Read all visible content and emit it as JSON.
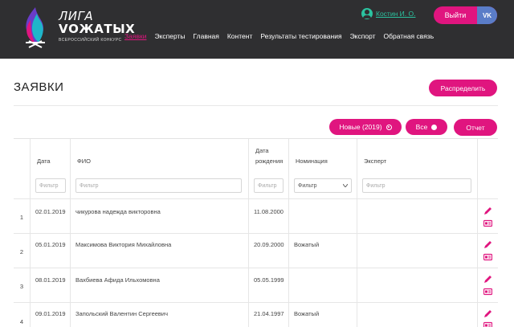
{
  "header": {
    "logo_line1": "ЛИГА",
    "logo_line2": "VОЖАТЫХ",
    "logo_sub": "всероссийский конкурс",
    "nav": [
      "Заявки",
      "Эксперты",
      "Главная",
      "Контент",
      "Результаты тестирования",
      "Экспорт",
      "Обратная связь"
    ],
    "user_name": "Костин И. О.",
    "logout_label": "Выйти",
    "vk_label": "VK"
  },
  "page": {
    "title": "ЗАЯВКИ",
    "distribute_label": "Распределить",
    "filter_new_label": "Новые (2019)",
    "filter_all_label": "Все",
    "report_label": "Отчет"
  },
  "table": {
    "headers": {
      "date": "Дата",
      "fio": "ФИО",
      "birth_l1": "Дата",
      "birth_l2": "рождения",
      "nomination": "Номинация",
      "expert": "Эксперт"
    },
    "filter_placeholder": "Фильтр",
    "nomination_filter_value": "Фильтр",
    "rows": [
      {
        "n": "1",
        "date": "02.01.2019",
        "fio": "чикурова надежда викторовна",
        "birth": "11.08.2000",
        "nomination": "",
        "expert": ""
      },
      {
        "n": "2",
        "date": "05.01.2019",
        "fio": "Максимова Виктория Михайловна",
        "birth": "20.09.2000",
        "nomination": "Вожатый",
        "expert": ""
      },
      {
        "n": "3",
        "date": "08.01.2019",
        "fio": "Вахбиева Афида Ильхомовна",
        "birth": "05.05.1999",
        "nomination": "",
        "expert": ""
      },
      {
        "n": "4",
        "date": "09.01.2019",
        "fio": "Запольский Валентин Сергеевич",
        "birth": "21.04.1997",
        "nomination": "Вожатый",
        "expert": ""
      }
    ]
  },
  "colors": {
    "accent": "#e0157f",
    "header_bg": "#2f2f31",
    "user_link": "#2bc3a0",
    "vk": "#5a7dc8"
  },
  "icons": [
    "flame-logo-icon",
    "user-icon",
    "radio-icon",
    "edit-pencil-icon",
    "id-card-icon"
  ]
}
